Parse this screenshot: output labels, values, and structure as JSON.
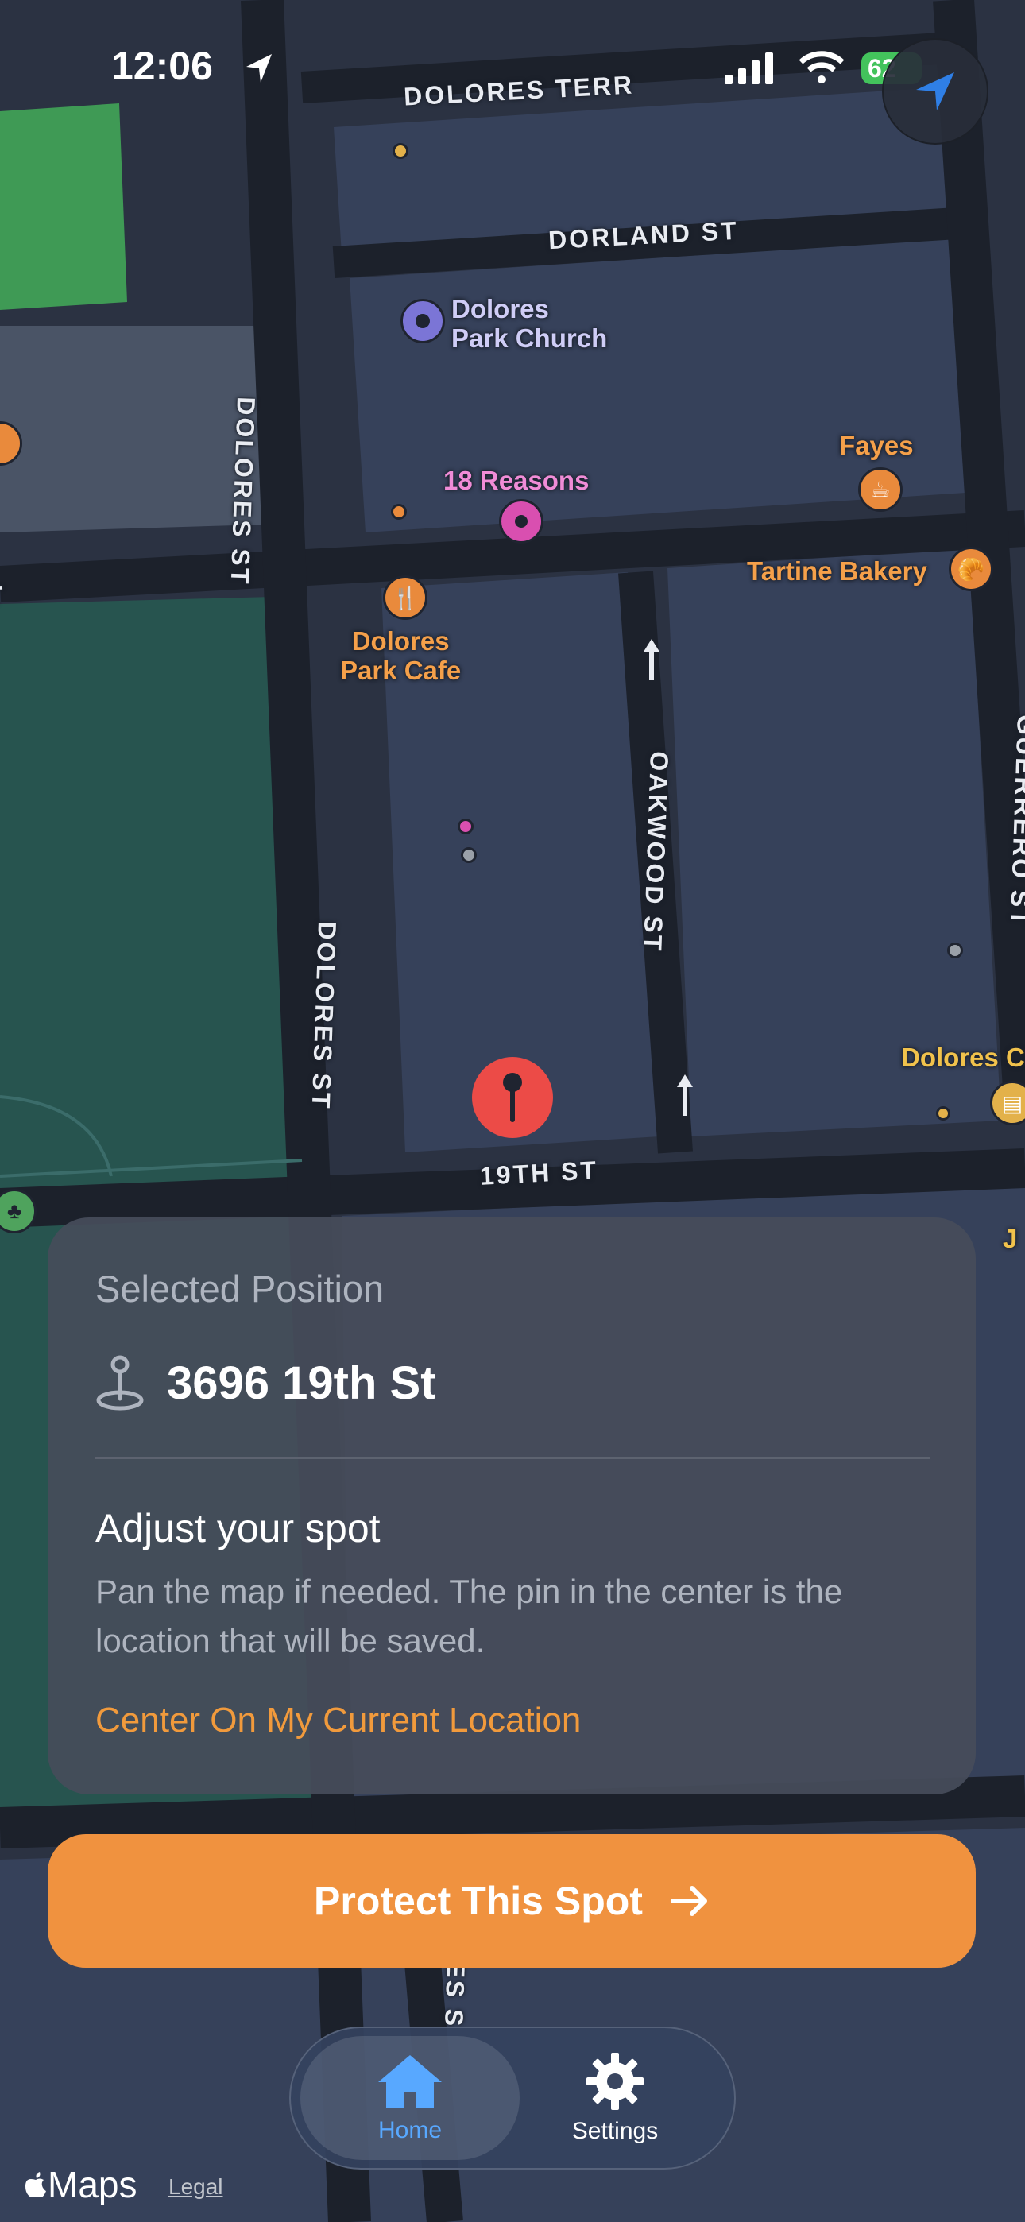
{
  "status_bar": {
    "time": "12:06",
    "battery": "62"
  },
  "map": {
    "streets": {
      "dolores_terr": "DOLORES TERR",
      "dorland_st": "DORLAND ST",
      "dolores_st_upper": "DOLORES ST",
      "dolores_st_lower": "DOLORES ST",
      "st_left": "ST",
      "oakwood_st": "OAKWOOD ST",
      "guerrero_st": "GUERRERO ST",
      "nineteenth_st": "19TH ST",
      "es_s": "ES S"
    },
    "pois": {
      "church": "Dolores\nPark Church",
      "reasons": "18 Reasons",
      "fayes": "Fayes",
      "tartine": "Tartine Bakery",
      "cafe": "Dolores\nPark Cafe",
      "dolores_c": "Dolores C",
      "j_partial": "J"
    }
  },
  "card": {
    "kicker": "Selected Position",
    "address": "3696 19th St",
    "heading": "Adjust your spot",
    "body": "Pan the map if needed. The pin in the center is the location that will be saved.",
    "link": "Center On My Current Location"
  },
  "primary_button": {
    "label": "Protect This Spot"
  },
  "tabs": [
    {
      "label": "Home",
      "icon": "house-icon",
      "selected": true
    },
    {
      "label": "Settings",
      "icon": "gear-icon",
      "selected": false
    }
  ],
  "footer": {
    "brand": "Maps",
    "legal": "Legal"
  },
  "colors": {
    "accent": "#f0923f",
    "tab_selected": "#58a8ff",
    "pin": "#ec4b47"
  }
}
